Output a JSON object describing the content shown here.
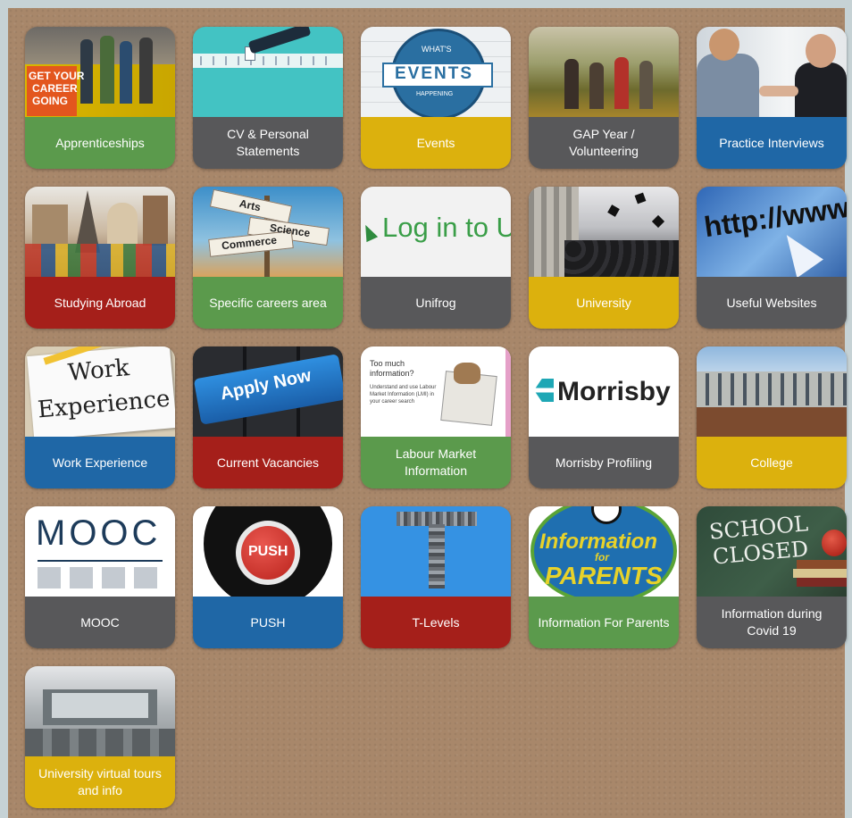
{
  "colors": {
    "green": "#5b9a4c",
    "grey": "#58585a",
    "yellow": "#dcb10d",
    "blue": "#1f67a6",
    "red": "#a51f1a"
  },
  "tiles": [
    {
      "label": "Apprenticeships",
      "image_text": [
        "GET YOUR",
        "CAREER",
        "GOING"
      ],
      "icon": "apprentices-photo"
    },
    {
      "label": "CV & Personal Statements",
      "icon": "cv-form-photo"
    },
    {
      "label": "Events",
      "image_text": [
        "WHAT'S",
        "EVENTS",
        "HAPPENING"
      ],
      "icon": "events-badge"
    },
    {
      "label": "GAP Year / Volunteering",
      "icon": "hikers-photo"
    },
    {
      "label": "Practice Interviews",
      "icon": "handshake-photo"
    },
    {
      "label": "Studying Abroad",
      "icon": "landmarks-collage"
    },
    {
      "label": "Specific careers area",
      "image_text": [
        "Arts",
        "Science",
        "Commerce"
      ],
      "icon": "signpost-photo"
    },
    {
      "label": "Unifrog",
      "image_text": [
        "Log in to U"
      ],
      "icon": "login-banner"
    },
    {
      "label": "University",
      "icon": "graduation-caps-photo"
    },
    {
      "label": "Useful Websites",
      "image_text": [
        "http://www"
      ],
      "icon": "url-cursor-photo"
    },
    {
      "label": "Work Experience",
      "image_text": [
        "Work",
        "Experience"
      ],
      "icon": "work-experience-note"
    },
    {
      "label": "Current Vacancies",
      "image_text": [
        "Apply Now"
      ],
      "icon": "apply-now-key"
    },
    {
      "label": "Labour Market Information",
      "image_text": [
        "Too much information?",
        "Understand and use Labour Market Information (LMI) in your career search"
      ],
      "icon": "lmi-dog-newspaper"
    },
    {
      "label": "Morrisby Profiling",
      "image_text": [
        "Morrisby"
      ],
      "icon": "morrisby-logo"
    },
    {
      "label": "College",
      "icon": "college-building-photo"
    },
    {
      "label": "MOOC",
      "image_text": [
        "MOOC"
      ],
      "icon": "mooc-diagram"
    },
    {
      "label": "PUSH",
      "image_text": [
        "PUSH"
      ],
      "icon": "push-button"
    },
    {
      "label": "T-Levels",
      "image_text": [
        "T"
      ],
      "icon": "t-mosaic"
    },
    {
      "label": "Information For Parents",
      "image_text": [
        "Information",
        "for",
        "PARENTS"
      ],
      "icon": "parents-logo"
    },
    {
      "label": "Information during Covid 19",
      "image_text": [
        "SCHOOL",
        "CLOSED"
      ],
      "icon": "chalkboard-apple"
    },
    {
      "label": "University virtual tours and info",
      "icon": "virtual-tour-room"
    }
  ]
}
